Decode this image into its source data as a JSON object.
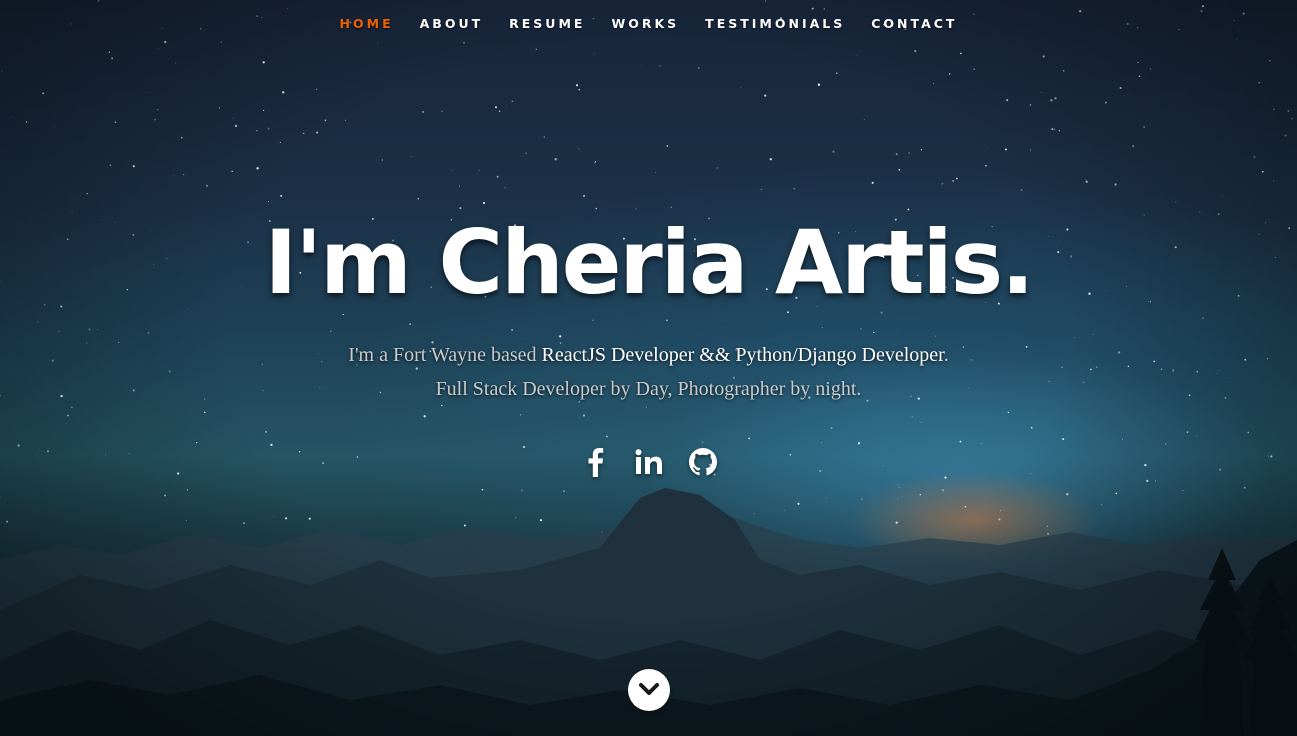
{
  "nav": {
    "items": [
      {
        "label": "HOME",
        "active": true
      },
      {
        "label": "ABOUT",
        "active": false
      },
      {
        "label": "RESUME",
        "active": false
      },
      {
        "label": "WORKS",
        "active": false
      },
      {
        "label": "TESTIMONIALS",
        "active": false
      },
      {
        "label": "CONTACT",
        "active": false
      }
    ],
    "active_color": "#f06000"
  },
  "banner": {
    "headline": "I'm Cheria Artis.",
    "intro_prefix": "I'm a Fort Wayne based ",
    "intro_highlight": "ReactJS Developer && Python/Django Developer",
    "intro_suffix": ".",
    "intro_line2": "Full Stack Developer by Day, Photographer by night."
  },
  "social": [
    {
      "icon": "facebook-icon"
    },
    {
      "icon": "linkedin-icon"
    },
    {
      "icon": "github-icon"
    }
  ],
  "scroll_button": {
    "icon": "chevron-down-icon"
  }
}
